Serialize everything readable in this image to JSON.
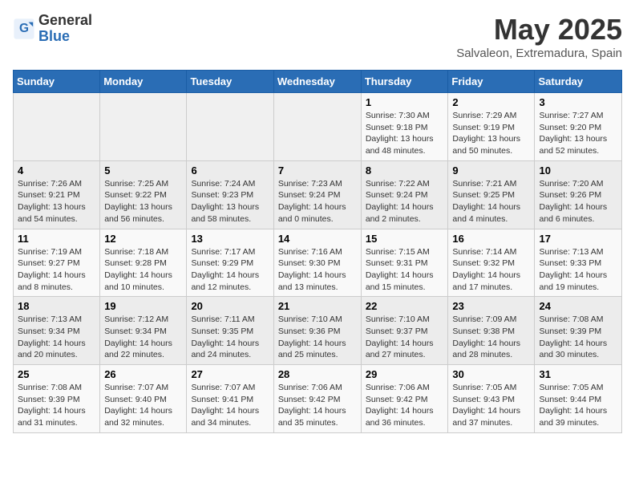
{
  "logo": {
    "general": "General",
    "blue": "Blue"
  },
  "header": {
    "month": "May 2025",
    "location": "Salvaleon, Extremadura, Spain"
  },
  "days_of_week": [
    "Sunday",
    "Monday",
    "Tuesday",
    "Wednesday",
    "Thursday",
    "Friday",
    "Saturday"
  ],
  "weeks": [
    [
      {
        "day": "",
        "info": ""
      },
      {
        "day": "",
        "info": ""
      },
      {
        "day": "",
        "info": ""
      },
      {
        "day": "",
        "info": ""
      },
      {
        "day": "1",
        "info": "Sunrise: 7:30 AM\nSunset: 9:18 PM\nDaylight: 13 hours\nand 48 minutes."
      },
      {
        "day": "2",
        "info": "Sunrise: 7:29 AM\nSunset: 9:19 PM\nDaylight: 13 hours\nand 50 minutes."
      },
      {
        "day": "3",
        "info": "Sunrise: 7:27 AM\nSunset: 9:20 PM\nDaylight: 13 hours\nand 52 minutes."
      }
    ],
    [
      {
        "day": "4",
        "info": "Sunrise: 7:26 AM\nSunset: 9:21 PM\nDaylight: 13 hours\nand 54 minutes."
      },
      {
        "day": "5",
        "info": "Sunrise: 7:25 AM\nSunset: 9:22 PM\nDaylight: 13 hours\nand 56 minutes."
      },
      {
        "day": "6",
        "info": "Sunrise: 7:24 AM\nSunset: 9:23 PM\nDaylight: 13 hours\nand 58 minutes."
      },
      {
        "day": "7",
        "info": "Sunrise: 7:23 AM\nSunset: 9:24 PM\nDaylight: 14 hours\nand 0 minutes."
      },
      {
        "day": "8",
        "info": "Sunrise: 7:22 AM\nSunset: 9:24 PM\nDaylight: 14 hours\nand 2 minutes."
      },
      {
        "day": "9",
        "info": "Sunrise: 7:21 AM\nSunset: 9:25 PM\nDaylight: 14 hours\nand 4 minutes."
      },
      {
        "day": "10",
        "info": "Sunrise: 7:20 AM\nSunset: 9:26 PM\nDaylight: 14 hours\nand 6 minutes."
      }
    ],
    [
      {
        "day": "11",
        "info": "Sunrise: 7:19 AM\nSunset: 9:27 PM\nDaylight: 14 hours\nand 8 minutes."
      },
      {
        "day": "12",
        "info": "Sunrise: 7:18 AM\nSunset: 9:28 PM\nDaylight: 14 hours\nand 10 minutes."
      },
      {
        "day": "13",
        "info": "Sunrise: 7:17 AM\nSunset: 9:29 PM\nDaylight: 14 hours\nand 12 minutes."
      },
      {
        "day": "14",
        "info": "Sunrise: 7:16 AM\nSunset: 9:30 PM\nDaylight: 14 hours\nand 13 minutes."
      },
      {
        "day": "15",
        "info": "Sunrise: 7:15 AM\nSunset: 9:31 PM\nDaylight: 14 hours\nand 15 minutes."
      },
      {
        "day": "16",
        "info": "Sunrise: 7:14 AM\nSunset: 9:32 PM\nDaylight: 14 hours\nand 17 minutes."
      },
      {
        "day": "17",
        "info": "Sunrise: 7:13 AM\nSunset: 9:33 PM\nDaylight: 14 hours\nand 19 minutes."
      }
    ],
    [
      {
        "day": "18",
        "info": "Sunrise: 7:13 AM\nSunset: 9:34 PM\nDaylight: 14 hours\nand 20 minutes."
      },
      {
        "day": "19",
        "info": "Sunrise: 7:12 AM\nSunset: 9:34 PM\nDaylight: 14 hours\nand 22 minutes."
      },
      {
        "day": "20",
        "info": "Sunrise: 7:11 AM\nSunset: 9:35 PM\nDaylight: 14 hours\nand 24 minutes."
      },
      {
        "day": "21",
        "info": "Sunrise: 7:10 AM\nSunset: 9:36 PM\nDaylight: 14 hours\nand 25 minutes."
      },
      {
        "day": "22",
        "info": "Sunrise: 7:10 AM\nSunset: 9:37 PM\nDaylight: 14 hours\nand 27 minutes."
      },
      {
        "day": "23",
        "info": "Sunrise: 7:09 AM\nSunset: 9:38 PM\nDaylight: 14 hours\nand 28 minutes."
      },
      {
        "day": "24",
        "info": "Sunrise: 7:08 AM\nSunset: 9:39 PM\nDaylight: 14 hours\nand 30 minutes."
      }
    ],
    [
      {
        "day": "25",
        "info": "Sunrise: 7:08 AM\nSunset: 9:39 PM\nDaylight: 14 hours\nand 31 minutes."
      },
      {
        "day": "26",
        "info": "Sunrise: 7:07 AM\nSunset: 9:40 PM\nDaylight: 14 hours\nand 32 minutes."
      },
      {
        "day": "27",
        "info": "Sunrise: 7:07 AM\nSunset: 9:41 PM\nDaylight: 14 hours\nand 34 minutes."
      },
      {
        "day": "28",
        "info": "Sunrise: 7:06 AM\nSunset: 9:42 PM\nDaylight: 14 hours\nand 35 minutes."
      },
      {
        "day": "29",
        "info": "Sunrise: 7:06 AM\nSunset: 9:42 PM\nDaylight: 14 hours\nand 36 minutes."
      },
      {
        "day": "30",
        "info": "Sunrise: 7:05 AM\nSunset: 9:43 PM\nDaylight: 14 hours\nand 37 minutes."
      },
      {
        "day": "31",
        "info": "Sunrise: 7:05 AM\nSunset: 9:44 PM\nDaylight: 14 hours\nand 39 minutes."
      }
    ]
  ]
}
